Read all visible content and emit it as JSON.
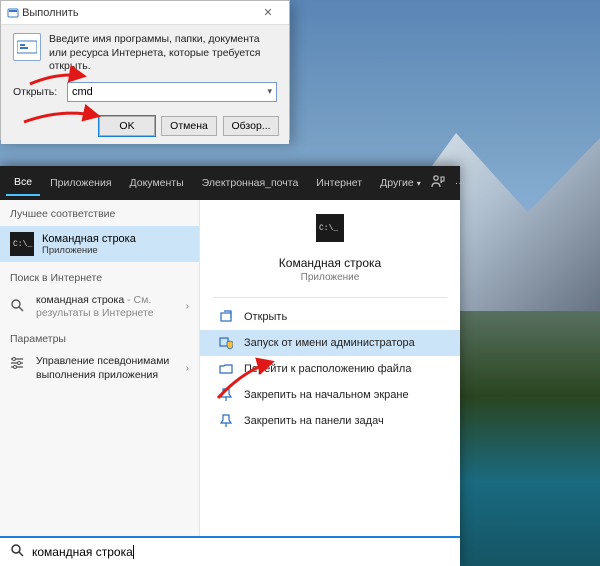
{
  "run": {
    "title": "Выполнить",
    "description": "Введите имя программы, папки, документа или ресурса Интернета, которые требуется открыть.",
    "open_label": "Открыть:",
    "command": "cmd",
    "buttons": {
      "ok": "OK",
      "cancel": "Отмена",
      "browse": "Обзор..."
    }
  },
  "tabs": {
    "all": "Все",
    "apps": "Приложения",
    "docs": "Документы",
    "email": "Электронная_почта",
    "internet": "Интернет",
    "other": "Другие"
  },
  "left": {
    "best_header": "Лучшее соответствие",
    "best_match": {
      "title": "Командная строка",
      "subtitle": "Приложение"
    },
    "web_header": "Поиск в Интернете",
    "web_item": {
      "query": "командная строка",
      "suffix": " - См. результаты в Интернете"
    },
    "params_header": "Параметры",
    "param_item": "Управление псевдонимами выполнения приложения"
  },
  "right": {
    "title": "Командная строка",
    "subtitle": "Приложение",
    "actions": {
      "open": "Открыть",
      "admin": "Запуск от имени администратора",
      "location": "Перейти к расположению файла",
      "pin_start": "Закрепить на начальном экране",
      "pin_task": "Закрепить на панели задач"
    }
  },
  "search": {
    "query": "командная строка"
  }
}
